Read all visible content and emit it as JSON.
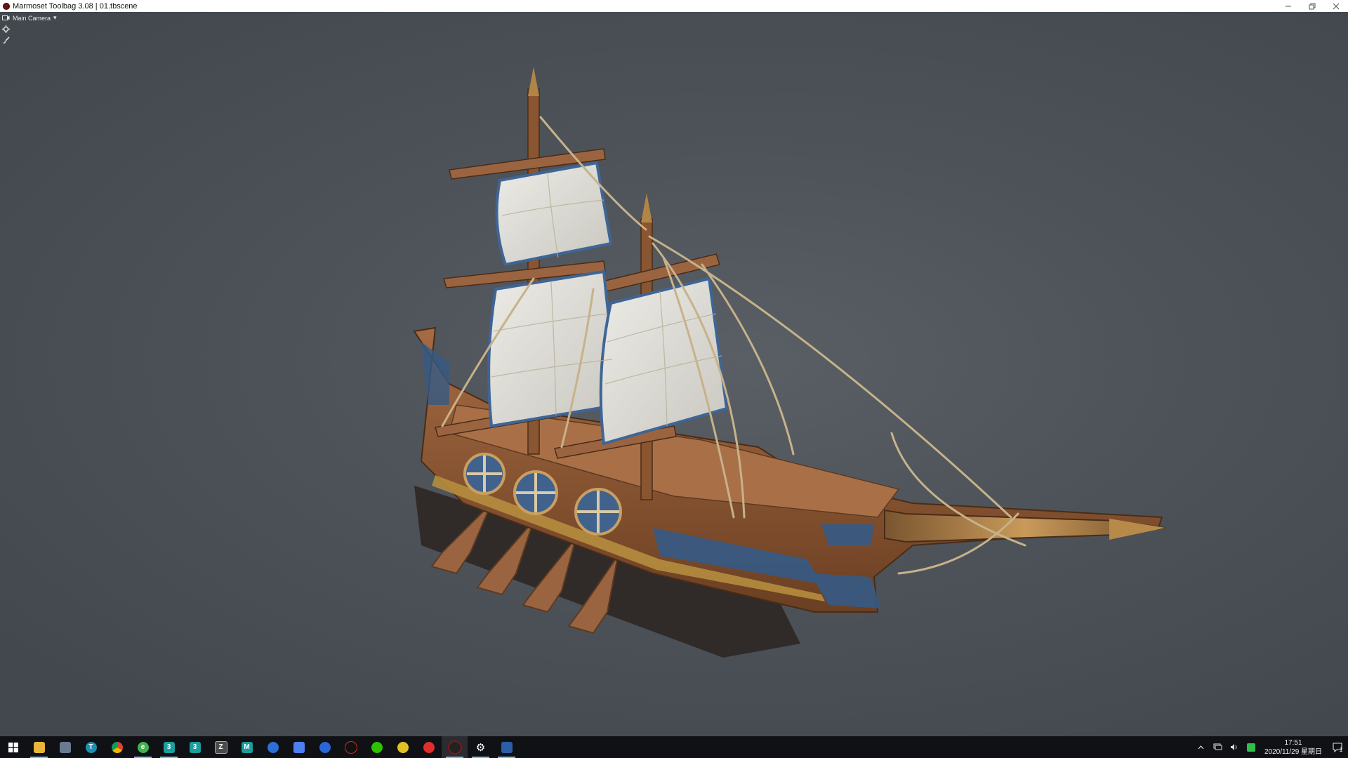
{
  "window": {
    "title": "Marmoset Toolbag 3.08  |  01.tbscene"
  },
  "viewport": {
    "camera_label": "Main Camera",
    "camera_dropdown_glyph": "▾"
  },
  "taskbar": {
    "apps": [
      {
        "name": "start-icon",
        "glyph": ""
      },
      {
        "name": "file-explorer-icon",
        "glyph": ""
      },
      {
        "name": "calculator-icon",
        "glyph": ""
      },
      {
        "name": "browser-t-icon",
        "glyph": "T"
      },
      {
        "name": "chrome-icon",
        "glyph": ""
      },
      {
        "name": "360-browser-icon",
        "glyph": "e"
      },
      {
        "name": "3dsmax-a-icon",
        "glyph": "3"
      },
      {
        "name": "3dsmax-b-icon",
        "glyph": "3"
      },
      {
        "name": "zbrush-icon",
        "glyph": "Z"
      },
      {
        "name": "maya-icon",
        "glyph": "M"
      },
      {
        "name": "blue-circle-app-icon",
        "glyph": ""
      },
      {
        "name": "feishu-icon",
        "glyph": ""
      },
      {
        "name": "baidu-netdisk-icon",
        "glyph": ""
      },
      {
        "name": "qq-icon",
        "glyph": ""
      },
      {
        "name": "wechat-icon",
        "glyph": ""
      },
      {
        "name": "yellow-app-icon",
        "glyph": ""
      },
      {
        "name": "netease-music-icon",
        "glyph": ""
      },
      {
        "name": "marmoset-icon",
        "glyph": ""
      },
      {
        "name": "settings-icon",
        "glyph": "⚙"
      },
      {
        "name": "remote-desktop-icon",
        "glyph": ""
      }
    ],
    "tray": {
      "clock_time": "17:51",
      "clock_date": "2020/11/29 星期日",
      "notification_count": "1"
    }
  }
}
